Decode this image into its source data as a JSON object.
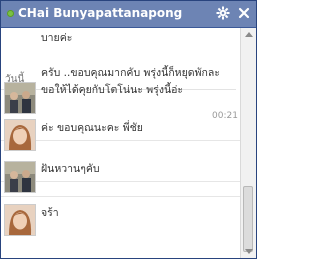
{
  "window": {
    "title": "CHai Bunyapattanapong",
    "status": "online",
    "gear_icon": "gear-icon",
    "close_icon": "close-icon"
  },
  "messages": {
    "prev_text": "บายค่ะ",
    "day_label": "วันนี้",
    "items": [
      {
        "sender": "contact",
        "lines": [
          "ครับ ..ขอบคุณมากคับ พรุ่งนี้ก็หยุดพักละ",
          "ขอให้ได้คุยกับโตโน่นะ พรุ่งนี้อ่ะ"
        ],
        "time": "00:21"
      },
      {
        "sender": "me",
        "lines": [
          "ค่ะ ขอบคุณนะคะ พี่ชัย"
        ],
        "time": ""
      },
      {
        "sender": "contact",
        "lines": [
          "ฝันหวานๆคับ"
        ],
        "time": ""
      },
      {
        "sender": "me",
        "lines": [
          "จร้า"
        ],
        "time": ""
      }
    ]
  },
  "colors": {
    "titlebar": "#6d84b4",
    "border": "#29447e",
    "online": "#7ac143"
  }
}
